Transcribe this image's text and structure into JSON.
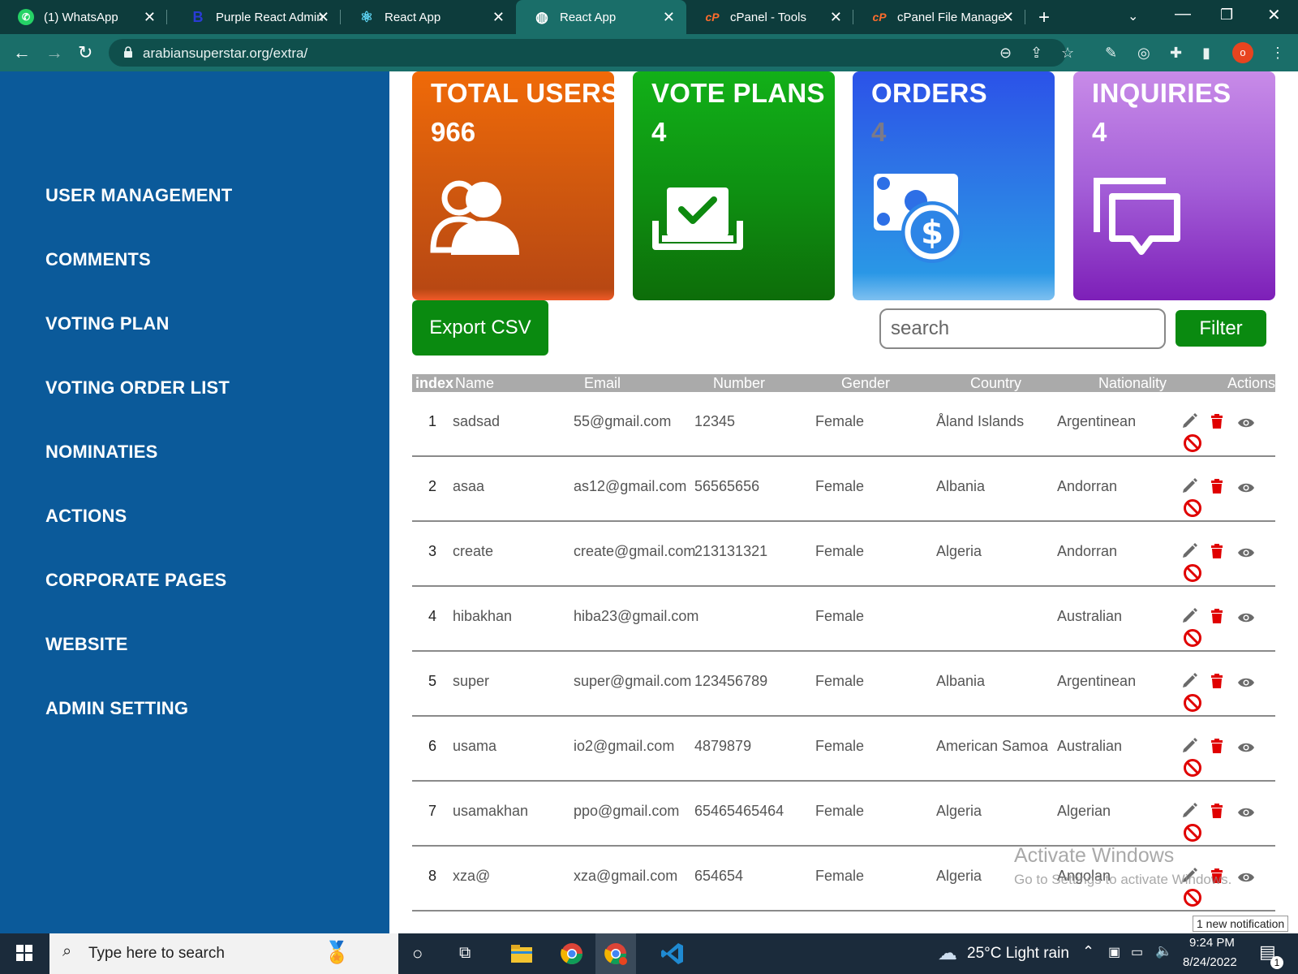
{
  "browser": {
    "tabs": [
      {
        "title": "(1) WhatsApp",
        "icon": "whatsapp-icon",
        "color": "#25d366"
      },
      {
        "title": "Purple React Admin",
        "icon": "bootstrap-icon",
        "color": "#2a3bd6"
      },
      {
        "title": "React App",
        "icon": "react-icon",
        "color": "#61dafb"
      },
      {
        "title": "React App",
        "icon": "globe-icon",
        "color": "#ffffff",
        "active": true
      },
      {
        "title": "cPanel - Tools",
        "icon": "cpanel-icon",
        "color": "#ff6c2c"
      },
      {
        "title": "cPanel File Manager",
        "icon": "cpanel-icon",
        "color": "#ff6c2c"
      }
    ],
    "url": "arabiansuperstar.org/extra/",
    "profile_initial": "o"
  },
  "sidebar": {
    "items": [
      {
        "label": "USER MANAGEMENT"
      },
      {
        "label": "COMMENTS"
      },
      {
        "label": "VOTING PLAN"
      },
      {
        "label": "VOTING ORDER LIST"
      },
      {
        "label": "NOMINATIES"
      },
      {
        "label": "ACTIONS"
      },
      {
        "label": "CORPORATE PAGES"
      },
      {
        "label": "WEBSITE"
      },
      {
        "label": "ADMIN SETTING"
      }
    ]
  },
  "cards": {
    "users": {
      "title": "TOTAL USERS",
      "value": "966",
      "icon": "users-icon"
    },
    "vote": {
      "title": "VOTE PLANS",
      "value": "4",
      "icon": "ballot-icon"
    },
    "orders": {
      "title": "ORDERS",
      "value": "4",
      "icon": "money-icon"
    },
    "inquiries": {
      "title": "INQUIRIES",
      "value": "4",
      "icon": "chat-icon"
    }
  },
  "toolbar": {
    "export_label": "Export CSV",
    "search_placeholder": "search",
    "search_value": "",
    "filter_label": "Filter"
  },
  "table": {
    "headers": [
      "index",
      "Name",
      "Email",
      "Number",
      "Gender",
      "Country",
      "Nationality",
      "Actions"
    ],
    "rows": [
      {
        "index": "1",
        "name": "sadsad",
        "email": "55@gmail.com",
        "number": "12345",
        "gender": "Female",
        "country": "Åland Islands",
        "nationality": "Argentinean"
      },
      {
        "index": "2",
        "name": "asaa",
        "email": "as12@gmail.com",
        "number": "56565656",
        "gender": "Female",
        "country": "Albania",
        "nationality": "Andorran"
      },
      {
        "index": "3",
        "name": "create",
        "email": "create@gmail.com",
        "number": "213131321",
        "gender": "Female",
        "country": "Algeria",
        "nationality": "Andorran"
      },
      {
        "index": "4",
        "name": "hibakhan",
        "email": "hiba23@gmail.com",
        "number": "",
        "gender": "Female",
        "country": "",
        "nationality": "Australian"
      },
      {
        "index": "5",
        "name": "super",
        "email": "super@gmail.com",
        "number": "123456789",
        "gender": "Female",
        "country": "Albania",
        "nationality": "Argentinean"
      },
      {
        "index": "6",
        "name": "usama",
        "email": "io2@gmail.com",
        "number": "4879879",
        "gender": "Female",
        "country": "American Samoa",
        "nationality": "Australian"
      },
      {
        "index": "7",
        "name": "usamakhan",
        "email": "ppo@gmail.com",
        "number": "65465465464",
        "gender": "Female",
        "country": "Algeria",
        "nationality": "Algerian"
      },
      {
        "index": "8",
        "name": "xza@",
        "email": "xza@gmail.com",
        "number": "654654",
        "gender": "Female",
        "country": "Algeria",
        "nationality": "Angolan"
      }
    ]
  },
  "overlay": {
    "watermark_title": "Activate Windows",
    "watermark_sub": "Go to Settings to activate Windows.",
    "notification": "1 new notification"
  },
  "taskbar": {
    "search_placeholder": "Type here to search",
    "weather": "25°C  Light rain",
    "time": "9:24 PM",
    "date": "8/24/2022",
    "notif_count": "1"
  },
  "colors": {
    "sidebar": "#0b5a9a",
    "green_button": "#0a8a10",
    "delete_red": "#e00000",
    "block_red": "#e00000"
  }
}
